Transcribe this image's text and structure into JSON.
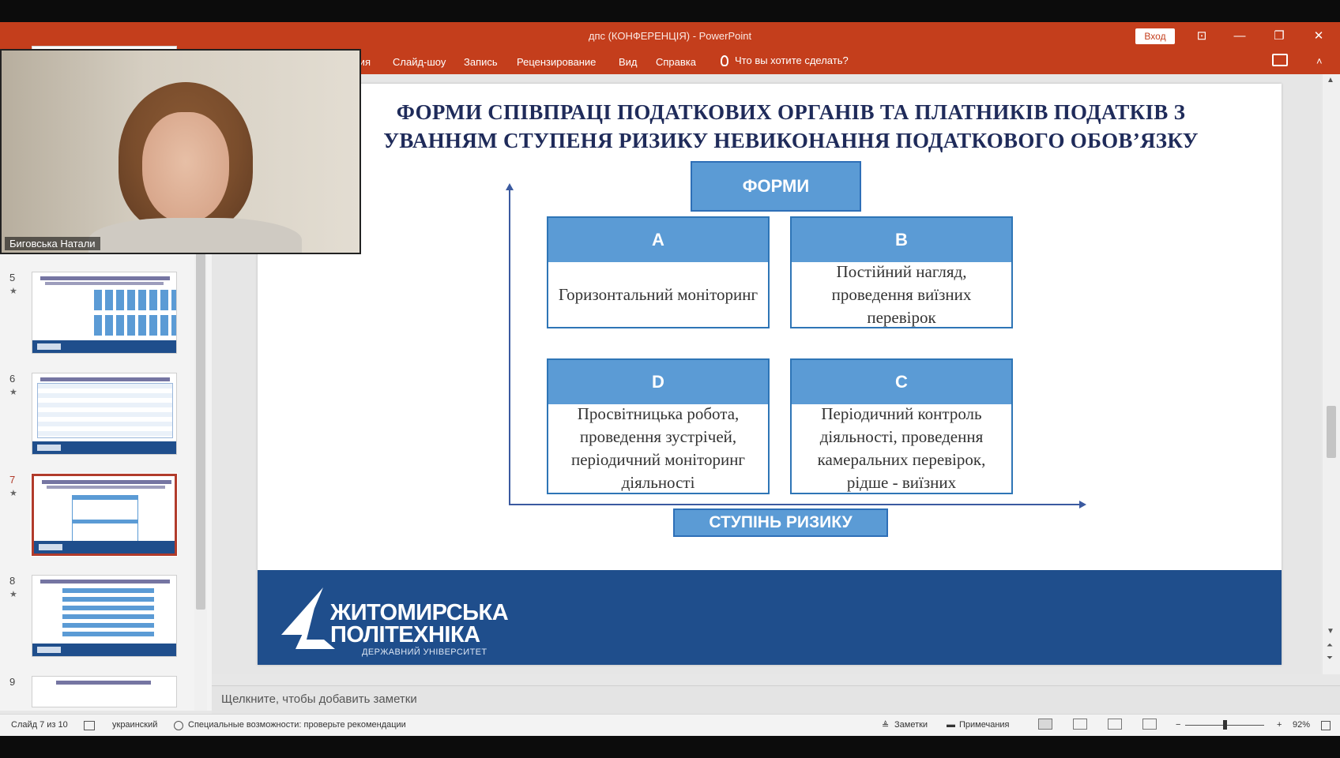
{
  "window": {
    "title": "дпс (КОНФЕРЕНЦІЯ)  -  PowerPoint",
    "signin_label": "Вход",
    "controls": {
      "ribbon_display": "⊡",
      "minimize": "—",
      "restore": "❐",
      "close": "✕"
    }
  },
  "ribbon": {
    "tabs": [
      "ация",
      "Слайд-шоу",
      "Запись",
      "Рецензирование",
      "Вид",
      "Справка"
    ],
    "tell_me": "Что вы хотите сделать?",
    "right_glyph": "˄"
  },
  "thumbnails": [
    {
      "number": "5",
      "star": "★"
    },
    {
      "number": "6",
      "star": "★"
    },
    {
      "number": "7",
      "star": "★",
      "active": true
    },
    {
      "number": "8",
      "star": "★"
    },
    {
      "number": "9",
      "star": ""
    }
  ],
  "slide": {
    "title_line1": "ФОРМИ СПІВПРАЦІ ПОДАТКОВИХ ОРГАНІВ ТА ПЛАТНИКІВ ПОДАТКІВ З",
    "title_line2": "УВАННЯМ СТУПЕНЯ РИЗИКУ НЕВИКОНАННЯ ПОДАТКОВОГО ОБОВ’ЯЗКУ",
    "forms_header": "ФОРМИ",
    "quadrants": {
      "a": {
        "letter": "A",
        "text": "Горизонтальний моніторинг"
      },
      "b": {
        "letter": "B",
        "text": "Постійний нагляд, проведення виїзних перевірок"
      },
      "d": {
        "letter": "D",
        "text": "Просвітницька робота, проведення зустрічей, періодичний моніторинг діяльності"
      },
      "c": {
        "letter": "C",
        "text": "Періодичний контроль діяльності, проведення камеральних перевірок, рідше - виїзних"
      }
    },
    "risk_label": "СТУПІНЬ РИЗИКУ",
    "logo": {
      "line1": "ЖИТОМИРСЬКА",
      "line2": "ПОЛІТЕХНІКА",
      "line3": "ДЕРЖАВНИЙ УНІВЕРСИТЕТ"
    }
  },
  "notes": {
    "placeholder": "Щелкните, чтобы добавить заметки"
  },
  "status": {
    "slide_info": "Слайд 7 из 10",
    "language": "украинский",
    "accessibility": "Специальные возможности: проверьте рекомендации",
    "notes_btn": "Заметки",
    "comments_btn": "Примечания",
    "zoom": "92%"
  },
  "webcam": {
    "participant_name": "Биговська Натали"
  }
}
